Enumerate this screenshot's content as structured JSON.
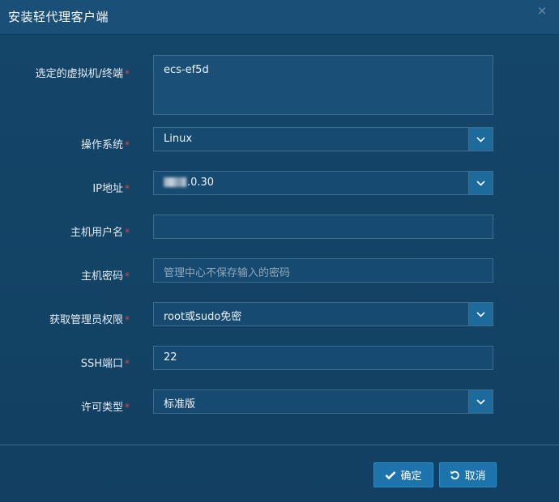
{
  "dialog": {
    "title": "安装轻代理客户端",
    "close_glyph": "×"
  },
  "form": {
    "vm": {
      "label": "选定的虚拟机/终端",
      "value": "ecs-ef5d"
    },
    "os": {
      "label": "操作系统",
      "value": "Linux"
    },
    "ip": {
      "label": "IP地址",
      "value_visible": ".0.30"
    },
    "user": {
      "label": "主机用户名",
      "value": ""
    },
    "password": {
      "label": "主机密码",
      "placeholder": "管理中心不保存输入的密码"
    },
    "privilege": {
      "label": "获取管理员权限",
      "value": "root或sudo免密"
    },
    "ssh_port": {
      "label": "SSH端口",
      "value": "22"
    },
    "license": {
      "label": "许可类型",
      "value": "标准版"
    },
    "required_mark": "*"
  },
  "footer": {
    "confirm_label": "确定",
    "cancel_label": "取消"
  },
  "colors": {
    "accent": "#1d74ad",
    "required": "#e0453a",
    "background": "#134466"
  }
}
